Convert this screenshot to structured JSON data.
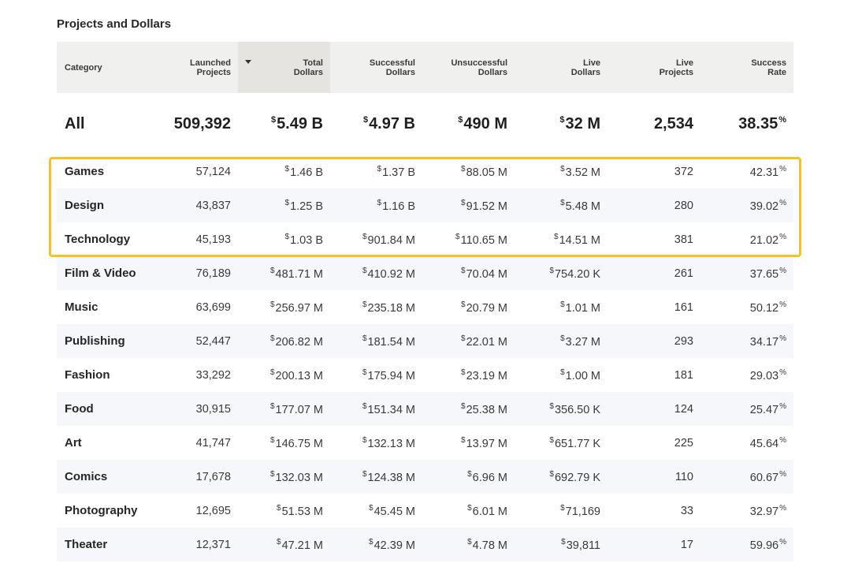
{
  "title": "Projects and Dollars",
  "header": {
    "category": "Category",
    "launched": [
      "Launched",
      "Projects"
    ],
    "total": [
      "Total",
      "Dollars"
    ],
    "successful": [
      "Successful",
      "Dollars"
    ],
    "unsuccessful": [
      "Unsuccessful",
      "Dollars"
    ],
    "live_dollars": [
      "Live",
      "Dollars"
    ],
    "live_projects": [
      "Live",
      "Projects"
    ],
    "success_rate": [
      "Success",
      "Rate"
    ],
    "sorted_column": "total"
  },
  "all": {
    "category": "All",
    "launched": "509,392",
    "total": "5.49 B",
    "successful": "4.97 B",
    "unsuccessful": "490 M",
    "live_dollars": "32 M",
    "live_projects": "2,534",
    "success_rate": "38.35"
  },
  "rows": [
    {
      "category": "Games",
      "launched": "57,124",
      "total": "1.46 B",
      "successful": "1.37 B",
      "unsuccessful": "88.05 M",
      "live_dollars": "3.52 M",
      "live_projects": "372",
      "success_rate": "42.31"
    },
    {
      "category": "Design",
      "launched": "43,837",
      "total": "1.25 B",
      "successful": "1.16 B",
      "unsuccessful": "91.52 M",
      "live_dollars": "5.48 M",
      "live_projects": "280",
      "success_rate": "39.02"
    },
    {
      "category": "Technology",
      "launched": "45,193",
      "total": "1.03 B",
      "successful": "901.84 M",
      "unsuccessful": "110.65 M",
      "live_dollars": "14.51 M",
      "live_projects": "381",
      "success_rate": "21.02"
    },
    {
      "category": "Film & Video",
      "launched": "76,189",
      "total": "481.71 M",
      "successful": "410.92 M",
      "unsuccessful": "70.04 M",
      "live_dollars": "754.20 K",
      "live_projects": "261",
      "success_rate": "37.65"
    },
    {
      "category": "Music",
      "launched": "63,699",
      "total": "256.97 M",
      "successful": "235.18 M",
      "unsuccessful": "20.79 M",
      "live_dollars": "1.01 M",
      "live_projects": "161",
      "success_rate": "50.12"
    },
    {
      "category": "Publishing",
      "launched": "52,447",
      "total": "206.82 M",
      "successful": "181.54 M",
      "unsuccessful": "22.01 M",
      "live_dollars": "3.27 M",
      "live_projects": "293",
      "success_rate": "34.17"
    },
    {
      "category": "Fashion",
      "launched": "33,292",
      "total": "200.13 M",
      "successful": "175.94 M",
      "unsuccessful": "23.19 M",
      "live_dollars": "1.00 M",
      "live_projects": "181",
      "success_rate": "29.03"
    },
    {
      "category": "Food",
      "launched": "30,915",
      "total": "177.07 M",
      "successful": "151.34 M",
      "unsuccessful": "25.38 M",
      "live_dollars": "356.50 K",
      "live_projects": "124",
      "success_rate": "25.47"
    },
    {
      "category": "Art",
      "launched": "41,747",
      "total": "146.75 M",
      "successful": "132.13 M",
      "unsuccessful": "13.97 M",
      "live_dollars": "651.77 K",
      "live_projects": "225",
      "success_rate": "45.64"
    },
    {
      "category": "Comics",
      "launched": "17,678",
      "total": "132.03 M",
      "successful": "124.38 M",
      "unsuccessful": "6.96 M",
      "live_dollars": "692.79 K",
      "live_projects": "110",
      "success_rate": "60.67"
    },
    {
      "category": "Photography",
      "launched": "12,695",
      "total": "51.53 M",
      "successful": "45.45 M",
      "unsuccessful": "6.01 M",
      "live_dollars": "71,169",
      "live_projects": "33",
      "success_rate": "32.97"
    },
    {
      "category": "Theater",
      "launched": "12,371",
      "total": "47.21 M",
      "successful": "42.39 M",
      "unsuccessful": "4.78 M",
      "live_dollars": "39,811",
      "live_projects": "17",
      "success_rate": "59.96"
    }
  ],
  "symbols": {
    "currency": "$",
    "percent": "%"
  },
  "colors": {
    "header_bg": "#f0f0ef",
    "sorted_header_bg": "#e6e4e1",
    "alt_row_bg": "#f6f7fa",
    "highlight_border": "#f5c328"
  }
}
